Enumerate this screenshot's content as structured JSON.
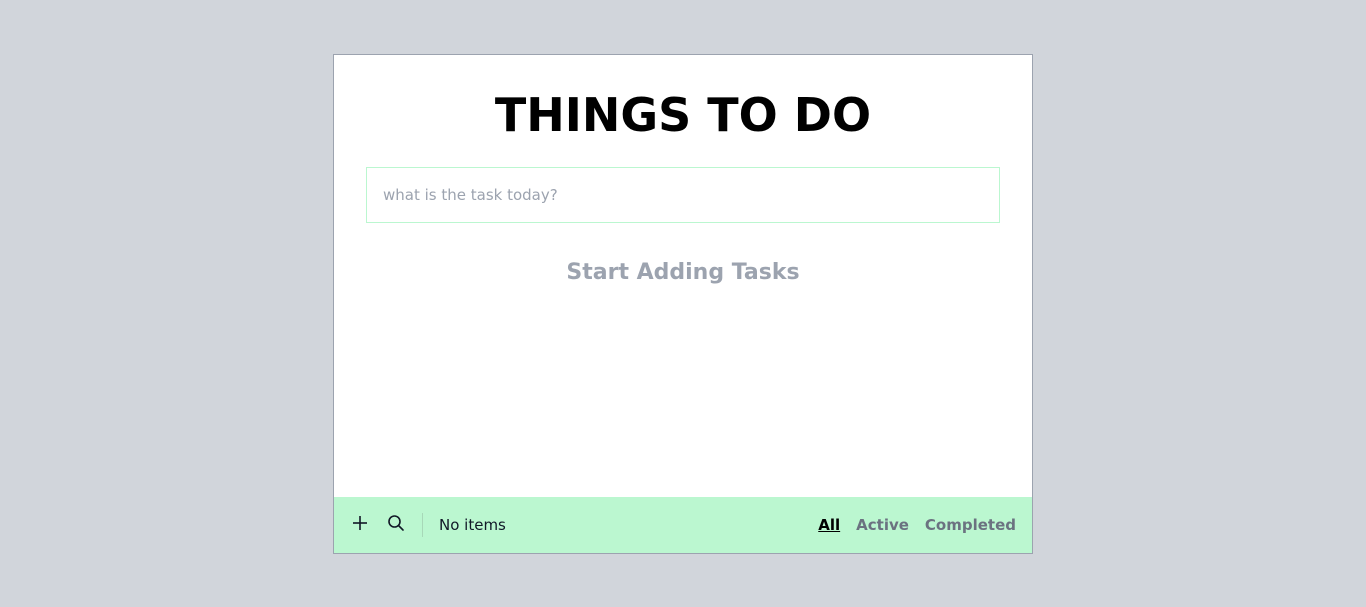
{
  "app": {
    "title": "THINGS TO DO",
    "input_placeholder": "what is the task today?",
    "empty_message": "Start Adding Tasks"
  },
  "footer": {
    "add_icon": "plus-icon",
    "search_icon": "search-icon",
    "count_text": "No items",
    "filters": [
      {
        "label": "All",
        "active": true
      },
      {
        "label": "Active",
        "active": false
      },
      {
        "label": "Completed",
        "active": false
      }
    ]
  },
  "colors": {
    "page_background": "#d1d5db",
    "card_background": "#ffffff",
    "footer_background": "#bbf7d0",
    "input_border": "#bbf7d0",
    "muted_text": "#9ca3af"
  }
}
